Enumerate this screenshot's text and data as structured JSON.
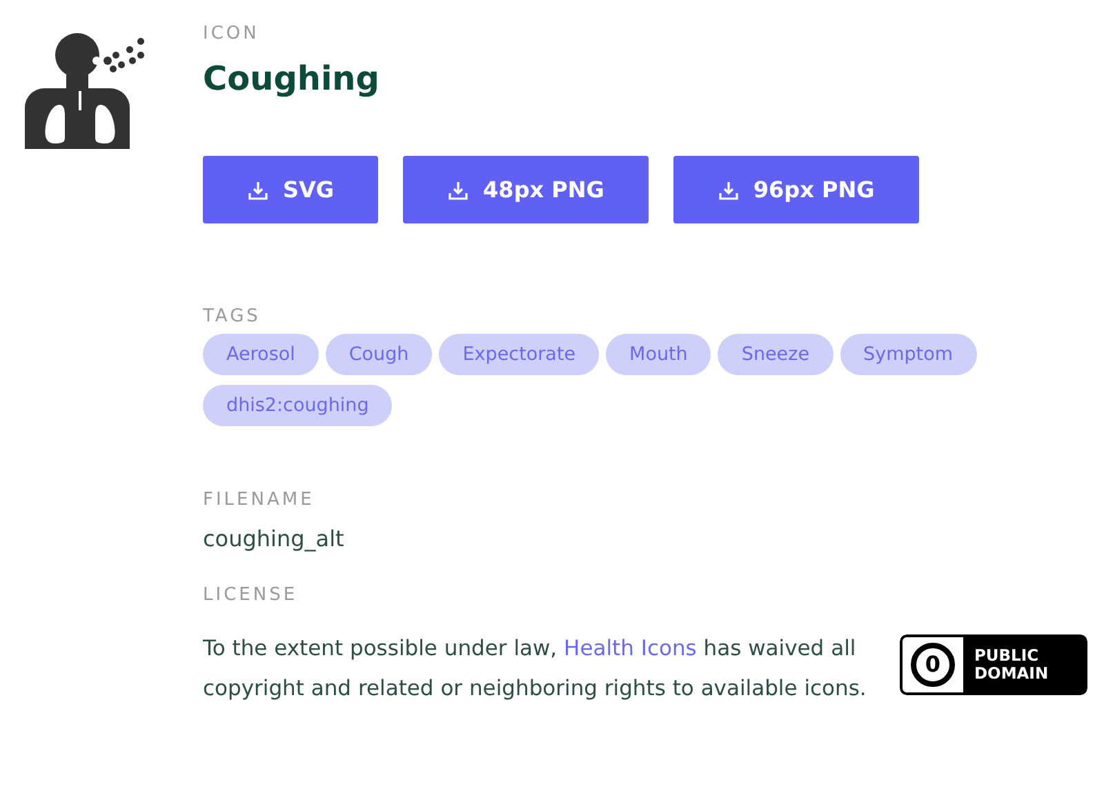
{
  "section_label": "ICON",
  "title": "Coughing",
  "downloads": [
    "SVG",
    "48px PNG",
    "96px PNG"
  ],
  "tags_label": "TAGS",
  "tags": [
    "Aerosol",
    "Cough",
    "Expectorate",
    "Mouth",
    "Sneeze",
    "Symptom",
    "dhis2:coughing"
  ],
  "filename_label": "FILENAME",
  "filename": "coughing_alt",
  "license_label": "LICENSE",
  "license": {
    "before": "To the extent possible under law, ",
    "link": "Health Icons",
    "after": " has waived all copyright and related or neighboring rights to available icons."
  },
  "badge": {
    "symbol": "0",
    "line_1": "PUBLIC",
    "line_2": "DOMAIN"
  }
}
